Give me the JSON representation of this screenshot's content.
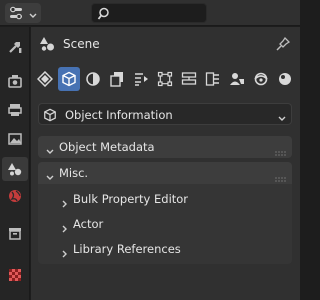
{
  "header": {
    "editor_type_icon": "properties-editor-icon",
    "search_icon": "search-icon"
  },
  "context": {
    "object_icon": "object-data-icon",
    "title": "Scene",
    "pin_icon": "pin-icon"
  },
  "property_tabs": [
    "tool-icon",
    "render-icon",
    "output-icon",
    "view-layer-icon",
    "scene-icon",
    "world-icon",
    "collection-icon",
    "texture-icon"
  ],
  "property_buttons": [
    "tool-icon",
    "object-icon",
    "modifier-icon",
    "particles-icon",
    "physics-icon",
    "constraints-icon",
    "data-icon",
    "material-icon",
    "shading-icon",
    "visibility-icon"
  ],
  "dropdown": {
    "label": "Object Information",
    "icon": "object-cube-icon"
  },
  "panels": {
    "object_metadata": "Object Metadata",
    "misc": "Misc.",
    "misc_items": [
      "Bulk Property Editor",
      "Actor",
      "Library References"
    ]
  },
  "colors": {
    "accent": "#4772b3",
    "panel_header": "#3d3d3d",
    "background": "#303030"
  }
}
